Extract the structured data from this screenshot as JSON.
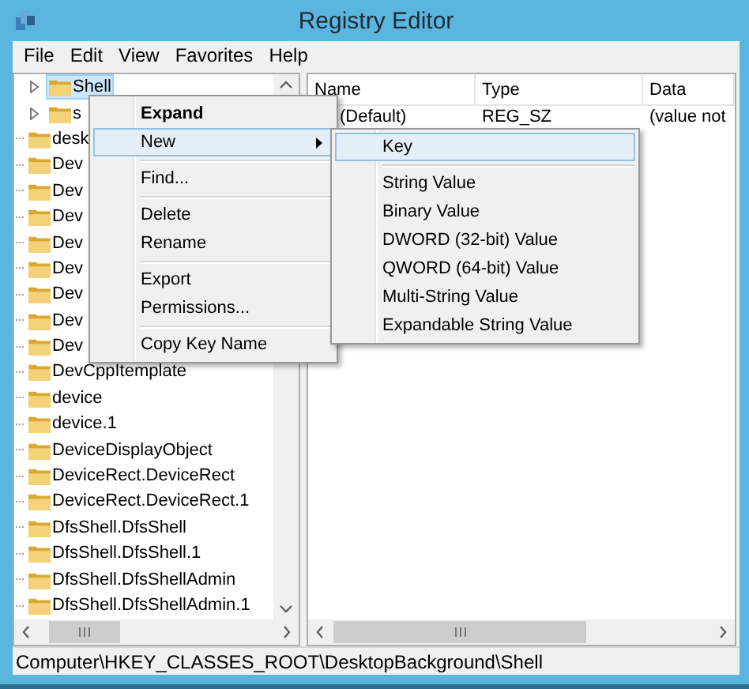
{
  "window": {
    "title": "Registry Editor"
  },
  "menu_bar": [
    "File",
    "Edit",
    "View",
    "Favorites",
    "Help"
  ],
  "tree": {
    "child_items": [
      {
        "label": "Shell",
        "selected": true,
        "has_children": true
      },
      {
        "label": "s",
        "selected": false,
        "has_children": true
      }
    ],
    "items": [
      {
        "label": "desk",
        "selected": false
      },
      {
        "label": "Dev",
        "selected": false
      },
      {
        "label": "Dev",
        "selected": false
      },
      {
        "label": "Dev",
        "selected": false
      },
      {
        "label": "Dev",
        "selected": false
      },
      {
        "label": "Dev",
        "selected": false
      },
      {
        "label": "Dev",
        "selected": false
      },
      {
        "label": "Dev",
        "selected": false
      },
      {
        "label": "Dev",
        "selected": false
      },
      {
        "label": "DevCppItemplate",
        "selected": false
      },
      {
        "label": "device",
        "selected": false
      },
      {
        "label": "device.1",
        "selected": false
      },
      {
        "label": "DeviceDisplayObject",
        "selected": false
      },
      {
        "label": "DeviceRect.DeviceRect",
        "selected": false
      },
      {
        "label": "DeviceRect.DeviceRect.1",
        "selected": false
      },
      {
        "label": "DfsShell.DfsShell",
        "selected": false
      },
      {
        "label": "DfsShell.DfsShell.1",
        "selected": false
      },
      {
        "label": "DfsShell.DfsShellAdmin",
        "selected": false
      },
      {
        "label": "DfsShell.DfsShellAdmin.1",
        "selected": false
      }
    ]
  },
  "values": {
    "columns": [
      "Name",
      "Type",
      "Data"
    ],
    "rows": [
      {
        "name": "(Default)",
        "type": "REG_SZ",
        "data": "(value not"
      }
    ]
  },
  "context_menu": [
    {
      "kind": "item",
      "label": "Expand",
      "bold": true,
      "selected": false,
      "submenu": false
    },
    {
      "kind": "item",
      "label": "New",
      "bold": false,
      "selected": true,
      "submenu": true
    },
    {
      "kind": "separator"
    },
    {
      "kind": "item",
      "label": "Find...",
      "bold": false,
      "selected": false,
      "submenu": false
    },
    {
      "kind": "separator"
    },
    {
      "kind": "item",
      "label": "Delete",
      "bold": false,
      "selected": false,
      "submenu": false
    },
    {
      "kind": "item",
      "label": "Rename",
      "bold": false,
      "selected": false,
      "submenu": false
    },
    {
      "kind": "separator"
    },
    {
      "kind": "item",
      "label": "Export",
      "bold": false,
      "selected": false,
      "submenu": false
    },
    {
      "kind": "item",
      "label": "Permissions...",
      "bold": false,
      "selected": false,
      "submenu": false
    },
    {
      "kind": "separator"
    },
    {
      "kind": "item",
      "label": "Copy Key Name",
      "bold": false,
      "selected": false,
      "submenu": false
    }
  ],
  "submenu": [
    {
      "kind": "item",
      "label": "Key",
      "selected": true
    },
    {
      "kind": "separator"
    },
    {
      "kind": "item",
      "label": "String Value",
      "selected": false
    },
    {
      "kind": "item",
      "label": "Binary Value",
      "selected": false
    },
    {
      "kind": "item",
      "label": "DWORD (32-bit) Value",
      "selected": false
    },
    {
      "kind": "item",
      "label": "QWORD (64-bit) Value",
      "selected": false
    },
    {
      "kind": "item",
      "label": "Multi-String Value",
      "selected": false
    },
    {
      "kind": "item",
      "label": "Expandable String Value",
      "selected": false
    }
  ],
  "status_bar": "Computer\\HKEY_CLASSES_ROOT\\DesktopBackground\\Shell"
}
